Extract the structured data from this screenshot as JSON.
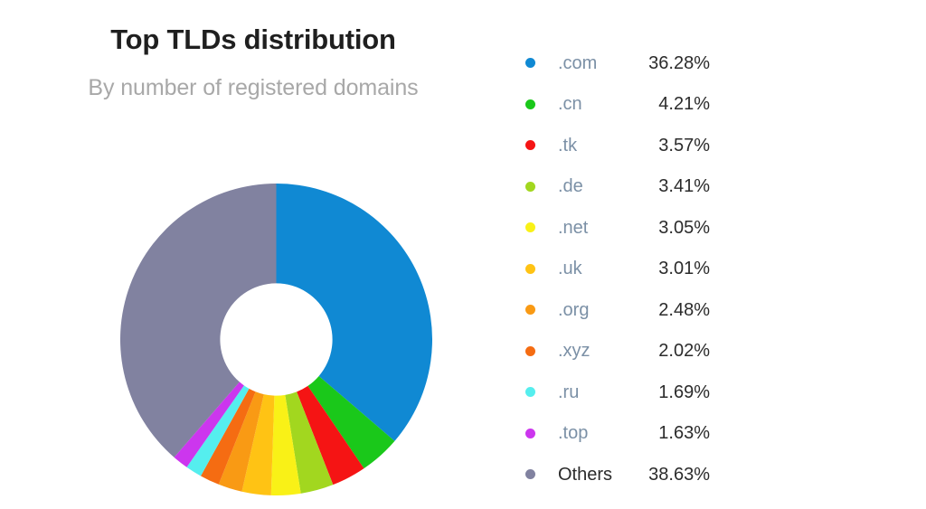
{
  "chart": {
    "title": "Top TLDs distribution",
    "subtitle": "By number of registered domains"
  },
  "chart_data": {
    "type": "pie",
    "variant": "donut",
    "title": "Top TLDs distribution",
    "subtitle": "By number of registered domains",
    "xlabel": "",
    "ylabel": "",
    "value_unit": "%",
    "start_angle_deg": 0,
    "direction": "clockwise",
    "inner_radius_ratio": 0.36,
    "legend_position": "right",
    "grid": false,
    "categories": [
      ".com",
      ".cn",
      ".tk",
      ".de",
      ".net",
      ".uk",
      ".org",
      ".xyz",
      ".ru",
      ".top",
      "Others"
    ],
    "values": [
      36.28,
      4.21,
      3.57,
      3.41,
      3.05,
      3.01,
      2.48,
      2.02,
      1.69,
      1.63,
      38.63
    ],
    "labels": [
      "36.28%",
      "4.21%",
      "3.57%",
      "3.41%",
      "3.05%",
      "3.01%",
      "2.48%",
      "2.02%",
      "1.69%",
      "1.63%",
      "38.63%"
    ],
    "colors": [
      "#1089d3",
      "#1ac81a",
      "#f51414",
      "#a2d71f",
      "#f9f117",
      "#ffc314",
      "#f99a14",
      "#f56c12",
      "#55eeee",
      "#cc36ee",
      "#8182a0"
    ],
    "slices": [
      {
        "name": ".com",
        "value": 36.28,
        "label": "36.28%",
        "color": "#1089d3"
      },
      {
        "name": ".cn",
        "value": 4.21,
        "label": "4.21%",
        "color": "#1ac81a"
      },
      {
        "name": ".tk",
        "value": 3.57,
        "label": "3.57%",
        "color": "#f51414"
      },
      {
        "name": ".de",
        "value": 3.41,
        "label": "3.41%",
        "color": "#a2d71f"
      },
      {
        "name": ".net",
        "value": 3.05,
        "label": "3.05%",
        "color": "#f9f117"
      },
      {
        "name": ".uk",
        "value": 3.01,
        "label": "3.01%",
        "color": "#ffc314"
      },
      {
        "name": ".org",
        "value": 2.48,
        "label": "2.48%",
        "color": "#f99a14"
      },
      {
        "name": ".xyz",
        "value": 2.02,
        "label": "2.02%",
        "color": "#f56c12"
      },
      {
        "name": ".ru",
        "value": 1.69,
        "label": "1.69%",
        "color": "#55eeee"
      },
      {
        "name": ".top",
        "value": 1.63,
        "label": "1.63%",
        "color": "#cc36ee"
      },
      {
        "name": "Others",
        "value": 38.63,
        "label": "38.63%",
        "color": "#8182a0"
      }
    ]
  },
  "legend": {
    "items": [
      {
        "label": ".com",
        "value": "36.28%",
        "color": "#1089d3",
        "is_link": true
      },
      {
        "label": ".cn",
        "value": "4.21%",
        "color": "#1ac81a",
        "is_link": true
      },
      {
        "label": ".tk",
        "value": "3.57%",
        "color": "#f51414",
        "is_link": true
      },
      {
        "label": ".de",
        "value": "3.41%",
        "color": "#a2d71f",
        "is_link": true
      },
      {
        "label": ".net",
        "value": "3.05%",
        "color": "#f9f117",
        "is_link": true
      },
      {
        "label": ".uk",
        "value": "3.01%",
        "color": "#ffc314",
        "is_link": true
      },
      {
        "label": ".org",
        "value": "2.48%",
        "color": "#f99a14",
        "is_link": true
      },
      {
        "label": ".xyz",
        "value": "2.02%",
        "color": "#f56c12",
        "is_link": true
      },
      {
        "label": ".ru",
        "value": "1.69%",
        "color": "#55eeee",
        "is_link": true
      },
      {
        "label": ".top",
        "value": "1.63%",
        "color": "#cc36ee",
        "is_link": true
      },
      {
        "label": "Others",
        "value": "38.63%",
        "color": "#8182a0",
        "is_link": false
      }
    ]
  },
  "theme": {
    "background": "#ffffff",
    "title_color": "#1f1f1f",
    "subtitle_color": "#a8a8a8",
    "legend_link_color": "#7b90a6",
    "legend_value_color": "#2b2b2b"
  }
}
